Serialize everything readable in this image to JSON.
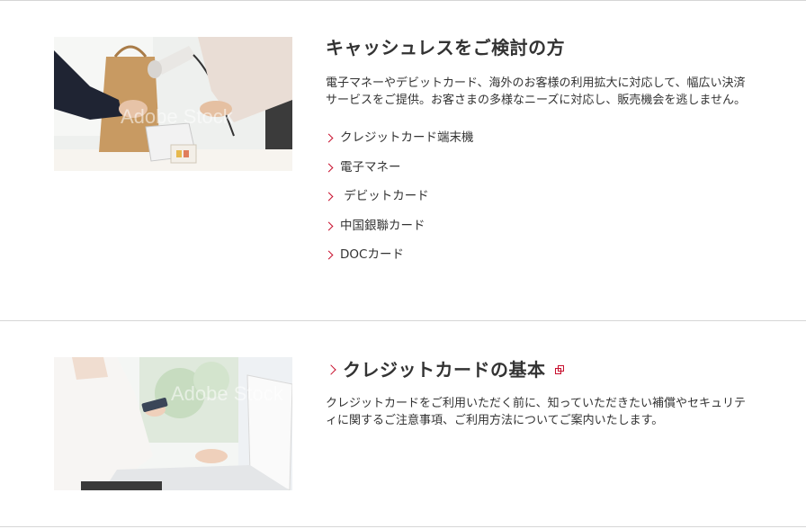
{
  "cashless": {
    "title": "キャッシュレスをご検討の方",
    "description": "電子マネーやデビットカード、海外のお客様の利用拡大に対応して、幅広い決済サービスをご提供。お客さまの多様なニーズに対応し、販売機会を逃しません。",
    "image_watermark": "Adobe Stock",
    "links": [
      {
        "label": "クレジットカード端末機"
      },
      {
        "label": "電子マネー"
      },
      {
        "label": " デビットカード"
      },
      {
        "label": "中国銀聯カード"
      },
      {
        "label": "DOCカード"
      }
    ]
  },
  "credit_basics": {
    "title": "クレジットカードの基本",
    "description": "クレジットカードをご利用いただく前に、知っていただきたい補償やセキュリティに関するご注意事項、ご利用方法についてご案内いたします。",
    "image_watermark": "Adobe Stock"
  },
  "colors": {
    "accent": "#c8102e",
    "text": "#333333",
    "divider": "#d6d6d6"
  },
  "icons": {
    "link_arrow": "chevron-right-icon",
    "external_link": "external-link-icon"
  }
}
